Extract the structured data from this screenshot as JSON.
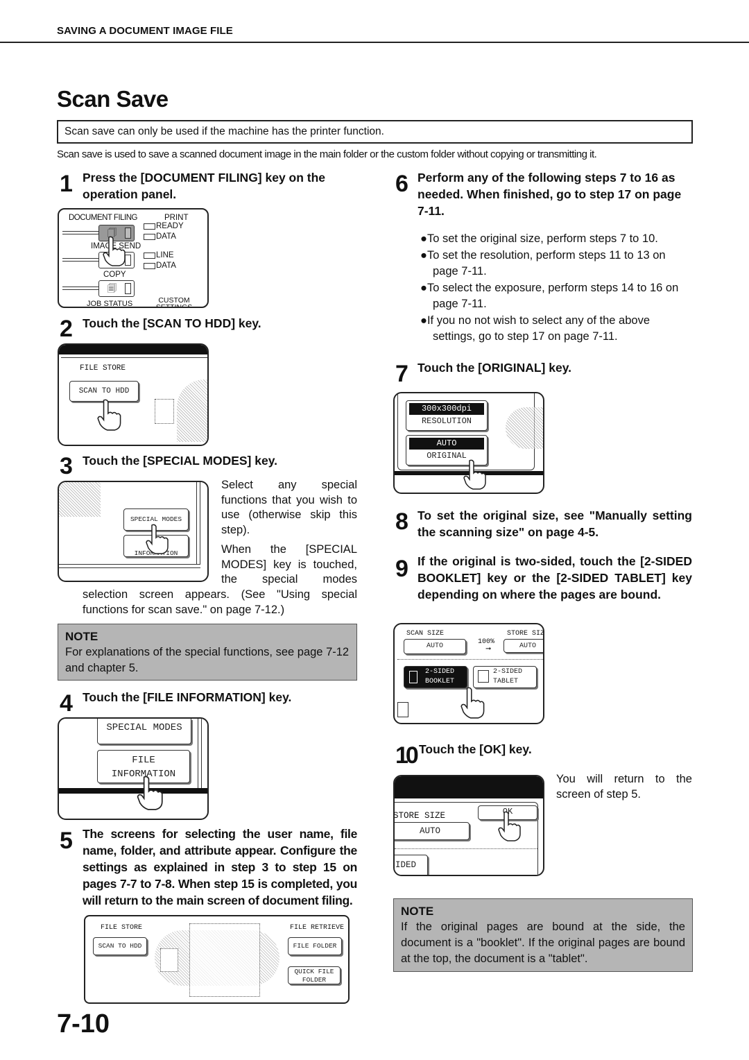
{
  "header": {
    "section": "SAVING A DOCUMENT IMAGE FILE"
  },
  "title": "Scan Save",
  "notice": "Scan save can only be used if the machine has the printer function.",
  "intro": "Scan save is used to save a scanned document image in the main folder or the custom folder without copying or transmitting it.",
  "steps": [
    {
      "num": "1",
      "text": "Press the [DOCUMENT FILING] key on the operation panel."
    },
    {
      "num": "2",
      "text": "Touch the [SCAN TO HDD] key."
    },
    {
      "num": "3",
      "text": "Touch the [SPECIAL MODES] key."
    },
    {
      "num": "4",
      "text": "Touch the [FILE INFORMATION] key."
    },
    {
      "num": "5",
      "text": "The screens for selecting the user name, file name, folder, and attribute appear. Configure the settings as explained in step 3 to step 15 on pages 7-7 to 7-8. When step 15 is completed, you will return to the main screen of document filing."
    },
    {
      "num": "6",
      "text": "Perform any of the following steps 7 to 16 as needed. When finished, go to step 17 on page 7-11."
    },
    {
      "num": "7",
      "text": "Touch the [ORIGINAL] key."
    },
    {
      "num": "8",
      "text": "To set the original size, see \"Manually setting the scanning size\" on page 4-5."
    },
    {
      "num": "9",
      "text": "If the original is two-sided, touch the [2-SIDED BOOKLET] key or the [2-SIDED TABLET] key depending on where the pages are bound."
    },
    {
      "num": "10",
      "text": "Touch the [OK] key."
    }
  ],
  "step3_body": {
    "para1": "Select any special functions that you wish to use (otherwise skip this step).",
    "para2a": "When the [SPECIAL MODES] key is touched, the special modes",
    "para2b": "selection screen appears. (See \"Using special functions for scan save.\" on page 7-12.)"
  },
  "step6_bullets": [
    "To set the original size, perform steps 7 to 10.",
    "To set the resolution, perform steps 11 to 13 on page 7-11.",
    "To select the exposure, perform steps 14 to 16 on page 7-11.",
    "If you no not wish to select any of the above settings, go to step 17 on page 7-11."
  ],
  "step10_body": "You will return to the screen of step 5.",
  "notes": [
    {
      "title": "NOTE",
      "text": "For explanations of the special functions, see page 7-12 and chapter 5."
    },
    {
      "title": "NOTE",
      "text": "If the original pages are bound at the side, the document is a \"booklet\". If the original pages are bound at the top, the document is a \"tablet\"."
    }
  ],
  "panel": {
    "document_filing": "DOCUMENT FILING",
    "image_send": "IMAGE SEND",
    "copy": "COPY",
    "job_status": "JOB STATUS",
    "custom_settings": "CUSTOM SETTINGS",
    "print": "PRINT",
    "ready": "READY",
    "data1": "DATA",
    "line": "LINE",
    "data2": "DATA"
  },
  "screens": {
    "file_store": "FILE STORE",
    "scan_to_hdd": "SCAN TO HDD",
    "special_modes": "SPECIAL MODES",
    "file_information_short": "INFORMATION",
    "file": "FILE",
    "information": "INFORMATION",
    "file_retrieve": "FILE RETRIEVE",
    "file_folder": "FILE FOLDER",
    "quick_file": "QUICK FILE",
    "folder": "FOLDER",
    "resolution_value": "300x300dpi",
    "resolution": "RESOLUTION",
    "original_value": "AUTO",
    "original": "ORIGINAL",
    "scan_size": "SCAN SIZE",
    "scan_size_value": "AUTO",
    "ratio": "100%",
    "store_size": "STORE SIZE",
    "store_size_value": "AUTO",
    "two_sided": "2-SIDED",
    "booklet": "BOOKLET",
    "tablet": "TABLET",
    "ok": "OK",
    "ided": "IDED"
  },
  "page_number": "7-10"
}
